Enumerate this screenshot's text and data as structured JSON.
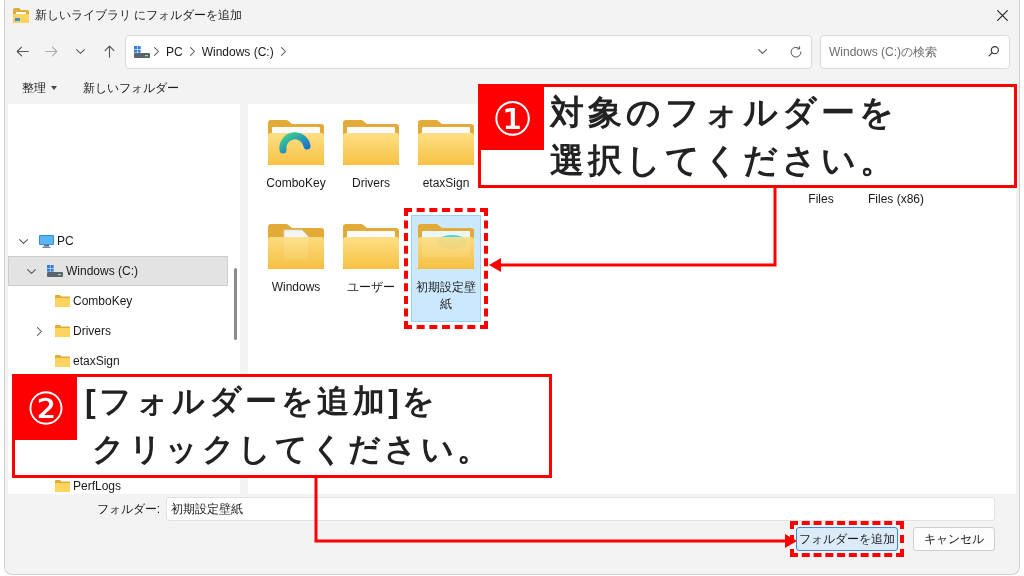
{
  "window": {
    "title": "新しいライブラリ にフォルダーを追加"
  },
  "navigation": {
    "back_disabled": false,
    "forward_disabled": true,
    "breadcrumb": [
      "PC",
      "Windows (C:)"
    ],
    "search": {
      "placeholder": "Windows (C:)の検索"
    }
  },
  "toolbar": {
    "organize": "整理",
    "new_folder": "新しいフォルダー"
  },
  "sidebar": {
    "tree": [
      {
        "kind": "branch",
        "label": "PC",
        "expanded": true,
        "selected": false,
        "children": [
          {
            "kind": "branch",
            "label": "Windows (C:)",
            "expanded": true,
            "selected": true,
            "children": [
              {
                "kind": "leaf",
                "label": "ComboKey",
                "selected": false
              },
              {
                "kind": "branch",
                "label": "Drivers",
                "expanded": false,
                "selected": false
              },
              {
                "kind": "leaf",
                "label": "etaxSign",
                "selected": false
              },
              {
                "kind": "covered"
              },
              {
                "kind": "covered"
              },
              {
                "kind": "covered"
              },
              {
                "kind": "leaf",
                "label": "PerfLogs",
                "selected": false
              }
            ]
          }
        ]
      }
    ]
  },
  "files": [
    {
      "kind": "folder",
      "label": "ComboKey",
      "selected": false
    },
    {
      "kind": "folder",
      "label": "Drivers",
      "selected": false
    },
    {
      "kind": "folder",
      "label": "etaxSign",
      "selected": false
    },
    {
      "kind": "covered"
    },
    {
      "kind": "covered"
    },
    {
      "kind": "covered"
    },
    {
      "kind": "covered"
    },
    {
      "kind": "covered",
      "label": "Files"
    },
    {
      "kind": "covered",
      "label": "Files (x86)"
    },
    {
      "kind": "covered"
    },
    {
      "kind": "folder",
      "label": "Windows",
      "selected": false
    },
    {
      "kind": "folder",
      "label": "ユーザー",
      "selected": false
    },
    {
      "kind": "folder",
      "label": "初期設定壁紙",
      "selected": true
    }
  ],
  "footer": {
    "field_label": "フォルダー:",
    "field_value": "初期設定壁紙",
    "buttons": [
      {
        "label": "フォルダーを追加",
        "default": true
      },
      {
        "label": "キャンセル",
        "default": false
      }
    ]
  },
  "callouts": [
    {
      "number": "①",
      "text": "対象のフォルダーを選択してください。"
    },
    {
      "number": "②",
      "text": "[フォルダーを追加]をクリックしてください。"
    }
  ]
}
